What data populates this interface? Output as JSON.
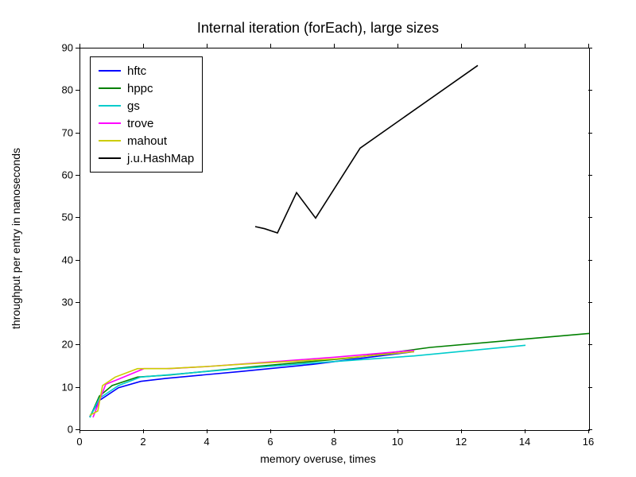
{
  "chart_data": {
    "type": "line",
    "title": "Internal iteration (forEach), large sizes",
    "xlabel": "memory overuse, times",
    "ylabel": "throughput per entry in nanoseconds",
    "xlim": [
      0,
      16
    ],
    "ylim": [
      0,
      90
    ],
    "xticks": [
      0,
      2,
      4,
      6,
      8,
      10,
      12,
      14,
      16
    ],
    "yticks": [
      0,
      10,
      20,
      30,
      40,
      50,
      60,
      70,
      80,
      90
    ],
    "series": [
      {
        "name": "hftc",
        "color": "#0000ff",
        "x": [
          0.3,
          0.6,
          1.2,
          1.9,
          2.7,
          5.0,
          7.3,
          10.5
        ],
        "y": [
          3.2,
          7.0,
          10.0,
          11.5,
          12.2,
          13.8,
          15.5,
          18.5
        ]
      },
      {
        "name": "hppc",
        "color": "#008000",
        "x": [
          0.3,
          0.6,
          1.0,
          1.8,
          2.8,
          5.5,
          8.5,
          11.0,
          16.0
        ],
        "y": [
          3.0,
          8.0,
          10.5,
          12.5,
          13.0,
          15.0,
          17.0,
          19.5,
          22.8
        ]
      },
      {
        "name": "gs",
        "color": "#00cccc",
        "x": [
          0.3,
          0.6,
          1.2,
          1.9,
          2.7,
          5.0,
          7.3,
          10.5,
          14.0
        ],
        "y": [
          3.0,
          7.5,
          10.5,
          12.5,
          13.0,
          14.5,
          15.8,
          17.5,
          20.0
        ]
      },
      {
        "name": "trove",
        "color": "#ff00ff",
        "x": [
          0.4,
          0.8,
          1.2,
          2.0,
          2.8,
          4.0,
          5.5,
          8.0,
          10.5
        ],
        "y": [
          3.0,
          10.8,
          12.0,
          14.5,
          14.5,
          15.0,
          15.8,
          17.2,
          18.8
        ]
      },
      {
        "name": "mahout",
        "color": "#cccc00",
        "x": [
          0.3,
          0.55,
          0.7,
          1.1,
          1.8,
          2.7,
          4.0,
          5.0,
          8.0,
          10.5
        ],
        "y": [
          3.5,
          4.5,
          10.5,
          12.5,
          14.5,
          14.5,
          15.0,
          15.5,
          16.8,
          18.5
        ]
      },
      {
        "name": "j.u.HashMap",
        "color": "#000000",
        "x": [
          5.5,
          5.8,
          6.2,
          6.8,
          7.4,
          8.8,
          12.5
        ],
        "y": [
          48.0,
          47.5,
          46.5,
          56.0,
          50.0,
          66.5,
          86.0
        ]
      }
    ]
  }
}
